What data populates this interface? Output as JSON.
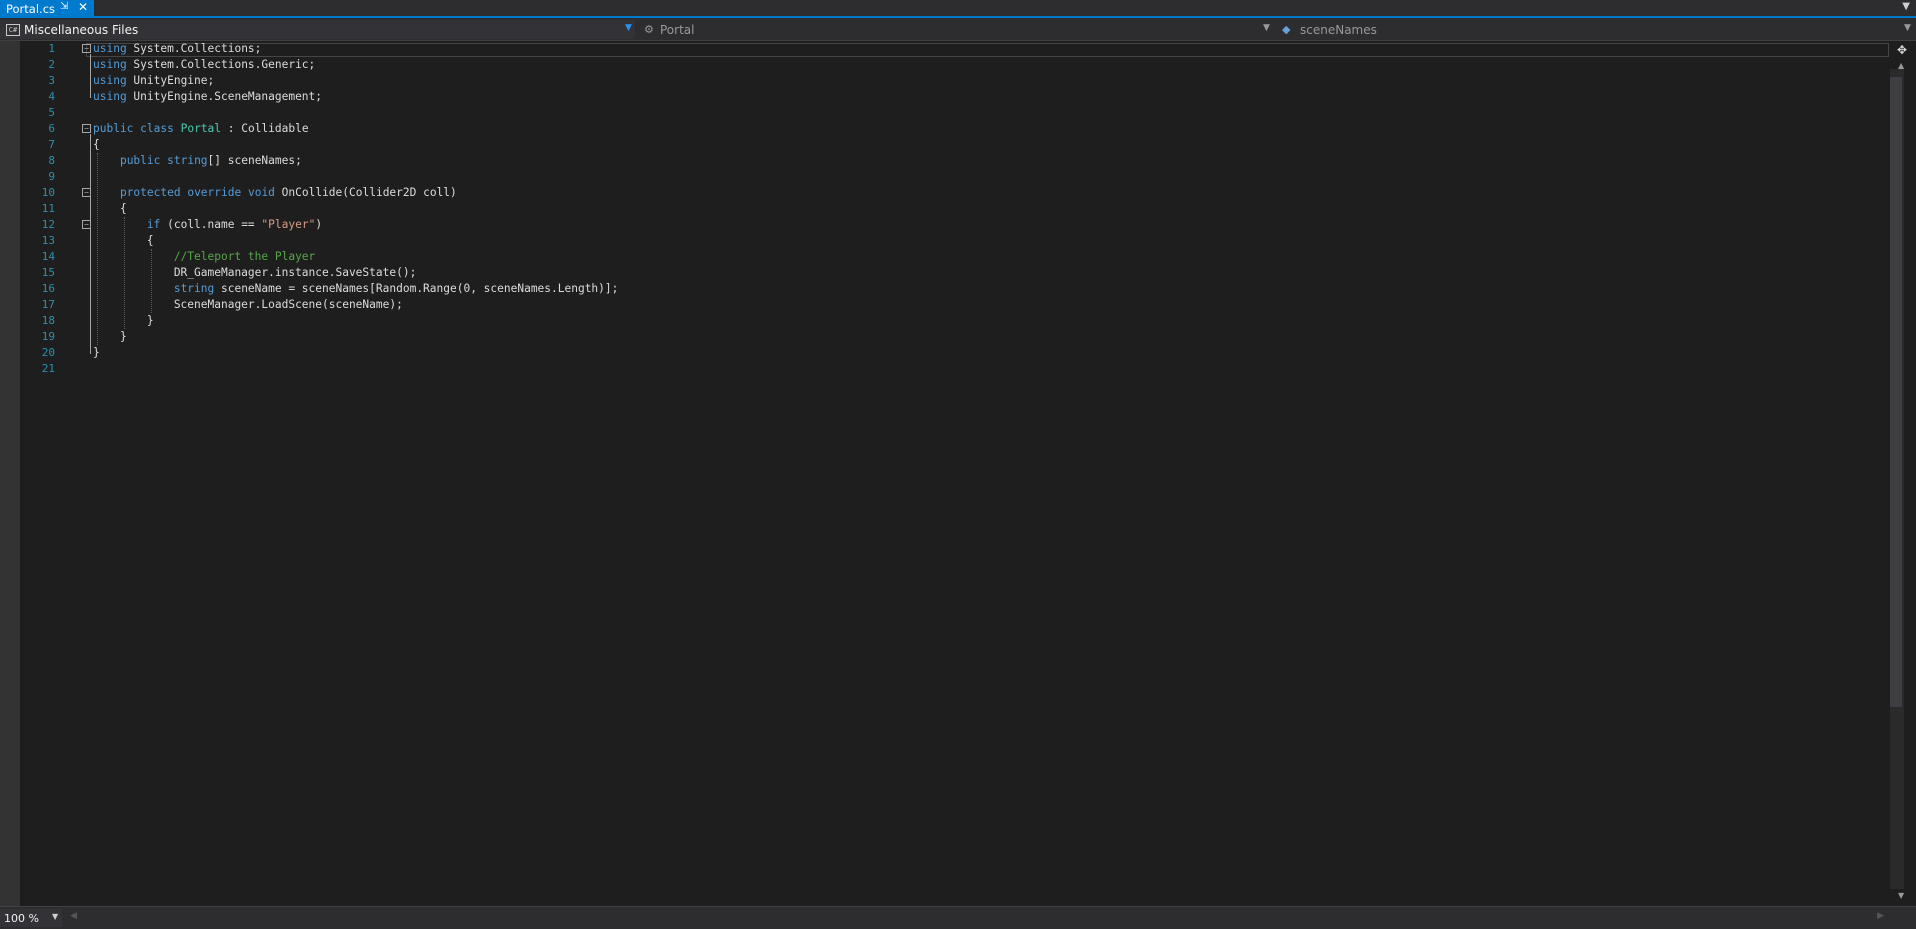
{
  "tab": {
    "title": "Portal.cs",
    "pin_icon": "pin-icon",
    "close_icon": "close-icon"
  },
  "tabstrip": {
    "overflow_icon": "chevron-down-icon"
  },
  "navbar": {
    "project": {
      "label": "Miscellaneous Files",
      "icon": "csharp-file-icon",
      "badge": "C#"
    },
    "type": {
      "label": "Portal",
      "icon": "class-icon"
    },
    "member": {
      "label": "sceneNames",
      "icon": "field-icon"
    }
  },
  "editor": {
    "line_numbers": [
      "1",
      "2",
      "3",
      "4",
      "5",
      "6",
      "7",
      "8",
      "9",
      "10",
      "11",
      "12",
      "13",
      "14",
      "15",
      "16",
      "17",
      "18",
      "19",
      "20",
      "21"
    ],
    "lines": [
      [
        {
          "t": "using",
          "c": "kw"
        },
        {
          "t": " System.Collections;",
          "c": ""
        }
      ],
      [
        {
          "t": "using",
          "c": "kw"
        },
        {
          "t": " System.Collections.Generic;",
          "c": ""
        }
      ],
      [
        {
          "t": "using",
          "c": "kw"
        },
        {
          "t": " UnityEngine;",
          "c": ""
        }
      ],
      [
        {
          "t": "using",
          "c": "kw"
        },
        {
          "t": " UnityEngine.SceneManagement;",
          "c": ""
        }
      ],
      [],
      [
        {
          "t": "public",
          "c": "kw"
        },
        {
          "t": " ",
          "c": ""
        },
        {
          "t": "class",
          "c": "kw"
        },
        {
          "t": " ",
          "c": ""
        },
        {
          "t": "Portal",
          "c": "type"
        },
        {
          "t": " : Collidable",
          "c": ""
        }
      ],
      [
        {
          "t": "{",
          "c": ""
        }
      ],
      [
        {
          "t": "    ",
          "c": ""
        },
        {
          "t": "public",
          "c": "kw"
        },
        {
          "t": " ",
          "c": ""
        },
        {
          "t": "string",
          "c": "kw"
        },
        {
          "t": "[] sceneNames;",
          "c": ""
        }
      ],
      [],
      [
        {
          "t": "    ",
          "c": ""
        },
        {
          "t": "protected",
          "c": "kw"
        },
        {
          "t": " ",
          "c": ""
        },
        {
          "t": "override",
          "c": "kw"
        },
        {
          "t": " ",
          "c": ""
        },
        {
          "t": "void",
          "c": "kw"
        },
        {
          "t": " OnCollide(Collider2D coll)",
          "c": ""
        }
      ],
      [
        {
          "t": "    {",
          "c": ""
        }
      ],
      [
        {
          "t": "        ",
          "c": ""
        },
        {
          "t": "if",
          "c": "kw"
        },
        {
          "t": " (coll.name == ",
          "c": ""
        },
        {
          "t": "\"Player\"",
          "c": "str"
        },
        {
          "t": ")",
          "c": ""
        }
      ],
      [
        {
          "t": "        {",
          "c": ""
        }
      ],
      [
        {
          "t": "            ",
          "c": ""
        },
        {
          "t": "//Teleport the Player",
          "c": "cmt"
        }
      ],
      [
        {
          "t": "            DR_GameManager.instance.SaveState();",
          "c": ""
        }
      ],
      [
        {
          "t": "            ",
          "c": ""
        },
        {
          "t": "string",
          "c": "kw"
        },
        {
          "t": " sceneName = sceneNames[Random.Range(0, sceneNames.Length)];",
          "c": ""
        }
      ],
      [
        {
          "t": "            SceneManager.LoadScene(sceneName);",
          "c": ""
        }
      ],
      [
        {
          "t": "        }",
          "c": ""
        }
      ],
      [
        {
          "t": "    }",
          "c": ""
        }
      ],
      [
        {
          "t": "}",
          "c": ""
        }
      ],
      []
    ],
    "fold_glyph": "−"
  },
  "scrollbar": {
    "split_icon": "split-window-icon",
    "up_icon": "scroll-up-icon",
    "down_icon": "scroll-down-icon"
  },
  "bottombar": {
    "zoom": "100 %",
    "zoom_icon": "chevron-down-icon"
  },
  "colors": {
    "accent": "#007acc",
    "keyword": "#569cd6",
    "type": "#4ec9b0",
    "string": "#d69d85",
    "comment": "#57a64a",
    "line_number": "#2b91af",
    "background": "#1e1e1e"
  }
}
